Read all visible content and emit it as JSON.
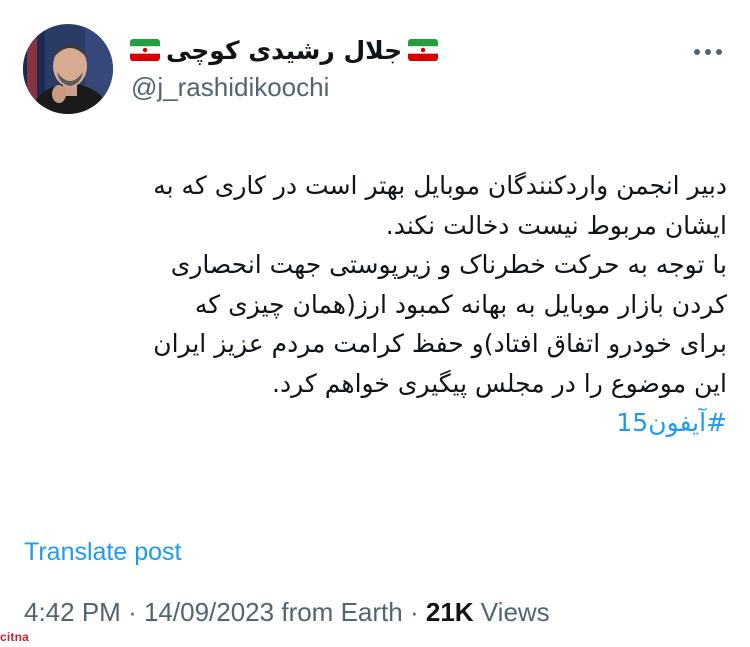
{
  "author": {
    "display_name": "جلال رشیدی کوچی",
    "flag_icon": "iran-flag-icon",
    "handle": "@j_rashidikoochi"
  },
  "more_icon": "more-options-icon",
  "tweet": {
    "lines": [
      "دبیر انجمن واردکنندگان موبایل بهتر است در کاری که به",
      "ایشان مربوط نیست دخالت نکند.",
      "با توجه به حرکت خطرناک و زیرپوستی جهت انحصاری",
      "کردن بازار موبایل به بهانه کمبود ارز(همان چیزی که",
      "برای خودرو اتفاق افتاد)و حفظ کرامت مردم عزیز ایران",
      "این موضوع را در مجلس پیگیری خواهم کرد."
    ],
    "hashtag": "#آیفون15"
  },
  "translate_label": "Translate post",
  "meta": {
    "time": "4:42 PM",
    "date": "14/09/2023",
    "source": "from Earth",
    "separator": "·",
    "views_count": "21K",
    "views_label": "Views"
  },
  "watermark": "citna",
  "colors": {
    "link": "#1d9bf0",
    "secondary_text": "#536471",
    "primary_text": "#0f1419",
    "watermark": "#d81e2c"
  }
}
